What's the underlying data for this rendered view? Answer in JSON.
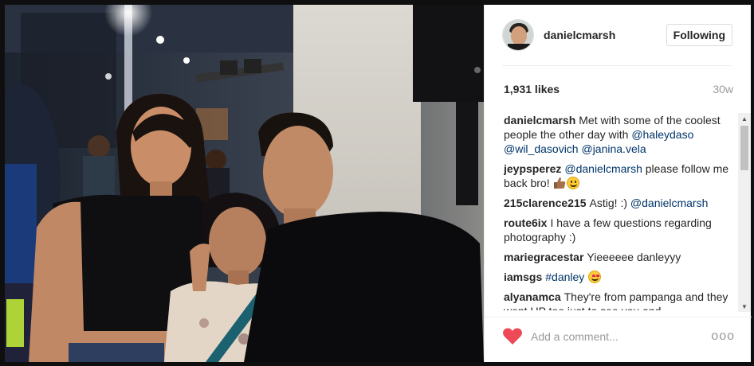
{
  "post": {
    "username": "danielcmarsh",
    "follow_label": "Following",
    "likes": "1,931 likes",
    "time_ago": "30w"
  },
  "comments": [
    {
      "user": "danielcmarsh",
      "parts": [
        {
          "text": "Met with some of the coolest people the other day with ",
          "mention": false
        },
        {
          "text": "@haleydaso",
          "mention": true
        },
        {
          "text": " ",
          "mention": false
        },
        {
          "text": "@wil_dasovich",
          "mention": true
        },
        {
          "text": " ",
          "mention": false
        },
        {
          "text": "@janina.vela",
          "mention": true
        }
      ]
    },
    {
      "user": "jeypsperez",
      "parts": [
        {
          "text": "@danielcmarsh",
          "mention": true
        },
        {
          "text": " please follow me back bro!",
          "mention": false
        }
      ],
      "emoji": [
        "thumbs-up-icon",
        "smile-emoji-icon"
      ]
    },
    {
      "user": "215clarence215",
      "parts": [
        {
          "text": "Astig! :) ",
          "mention": false
        },
        {
          "text": "@danielcmarsh",
          "mention": true
        }
      ]
    },
    {
      "user": "route6ix",
      "parts": [
        {
          "text": "I have a few questions regarding photography :)",
          "mention": false
        }
      ]
    },
    {
      "user": "mariegracestar",
      "parts": [
        {
          "text": "Yieeeeee danleyyy",
          "mention": false
        }
      ]
    },
    {
      "user": "iamsgs",
      "parts": [
        {
          "text": "#danley",
          "mention": true
        }
      ],
      "emoji": [
        "heart-eyes-emoji-icon"
      ]
    },
    {
      "user": "alyanamca",
      "parts": [
        {
          "text": "They're from pampanga and they went UP too just to see you and",
          "mention": false
        }
      ]
    }
  ],
  "footer": {
    "comment_placeholder": "Add a comment...",
    "more_label": "ooo"
  },
  "colors": {
    "mention": "#003569",
    "heart": "#ed4956",
    "text": "#262626",
    "muted": "#999999"
  },
  "icons": {
    "like": "heart-icon",
    "more": "more-options-icon",
    "scroll_up": "scroll-up-arrow-icon",
    "scroll_down": "scroll-down-arrow-icon"
  }
}
